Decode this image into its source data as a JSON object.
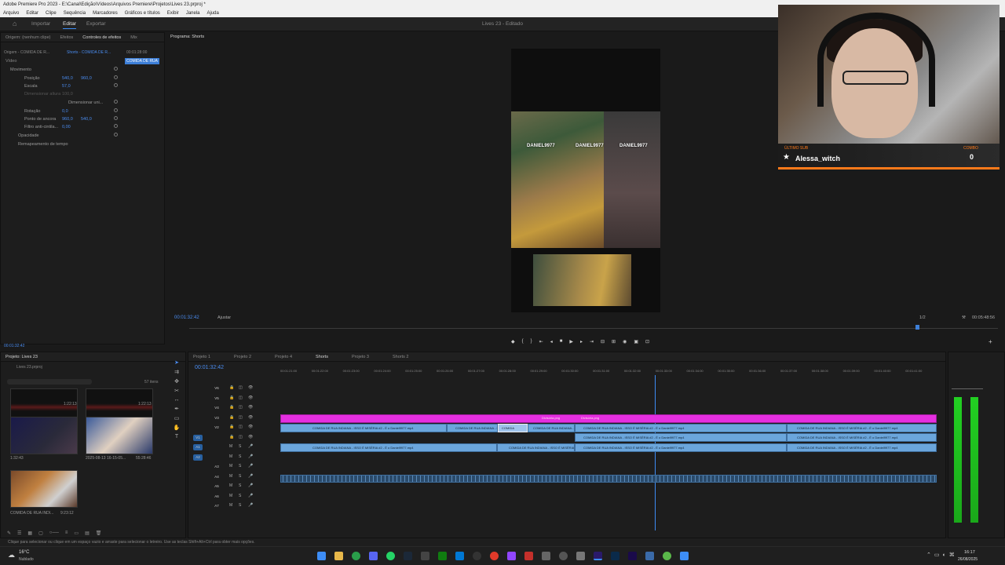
{
  "app": {
    "title": "Adobe Premiere Pro 2023 - E:\\Canal\\Edição\\Vídeos\\Arquivos Premiere\\Projetos\\Lives 23.prproj *",
    "project_status": "Lives 23 - Editado"
  },
  "menu": [
    "Arquivo",
    "Editar",
    "Clipe",
    "Sequência",
    "Marcadores",
    "Gráficos e títulos",
    "Exibir",
    "Janela",
    "Ajuda"
  ],
  "workspaces": {
    "import": "Importar",
    "edit": "Editar",
    "export": "Exportar"
  },
  "effects_panel": {
    "tabs": [
      "Origem: (nenhum clipe)",
      "Efeitos",
      "Controles de efeitos",
      "Mix",
      "Programa: Shorts"
    ],
    "source_label": "Origem - COMIDA DE R...",
    "sequence_label": "Shorts - COMIDA DE R...",
    "timecode": "00:01:28:00",
    "clip_label": "COMIDA DE RUA",
    "section_video": "Vídeo",
    "rows": [
      {
        "label": "Movimento"
      },
      {
        "label": "Posição",
        "v1": "540,0",
        "v2": "960,0"
      },
      {
        "label": "Escala",
        "v1": "57,0"
      },
      {
        "label": "Dimensionar altura",
        "v1": "100,0"
      },
      {
        "label": "Dimensionar uni..."
      },
      {
        "label": "Rotação",
        "v1": "0,0"
      },
      {
        "label": "Ponto de ancora",
        "v1": "960,0",
        "v2": "540,0"
      },
      {
        "label": "Filtro anti-cintila...",
        "v1": "0,00"
      },
      {
        "label": "Opacidade"
      },
      {
        "label": "Remapeamento de tempo"
      }
    ],
    "footer_timecode": "00:01:32:42"
  },
  "program_monitor": {
    "title": "Programa: Shorts",
    "timecode": "00:01:32:42",
    "fit": "Ajustar",
    "scale": "1/2",
    "duration": "00:05:48:56",
    "watermark": "DANIEL9977"
  },
  "stream_alert": {
    "last_sub_label": "ÚLTIMO SUB",
    "last_sub": "Alessa_witch",
    "combo_label": "COMBO",
    "combo": "0",
    "accent": "#ff7a1a"
  },
  "project_panel": {
    "title": "Projeto: Lives 23",
    "file": "Lives 23.prproj",
    "items_count": "57 itens",
    "items": [
      {
        "name": "",
        "dur": "1:22:13"
      },
      {
        "name": "",
        "dur": "1:22:13"
      },
      {
        "name": "",
        "dur": "1:32:43"
      },
      {
        "name": "2025-08-13 16-15-05...",
        "dur": "55:28:46"
      },
      {
        "name": "COMIDA DE RUA INDI...",
        "dur": "9:23:12"
      }
    ]
  },
  "timeline": {
    "tabs": [
      "Projeto 1",
      "Projeto 2",
      "Projeto 4",
      "Shorts",
      "Projeto 3",
      "Shorts 2"
    ],
    "active_tab": "Shorts",
    "timecode": "00:01:32:42",
    "ruler": [
      "00:01:21:00",
      "00:01:22:00",
      "00:01:23:00",
      "00:01:24:00",
      "00:01:25:00",
      "00:01:26:00",
      "00:01:27:00",
      "00:01:28:00",
      "00:01:29:00",
      "00:01:30:00",
      "00:01:31:00",
      "00:01:32:00",
      "00:01:33:00",
      "00:01:34:00",
      "00:01:35:00",
      "00:01:36:00",
      "00:01:37:00",
      "00:01:38:00",
      "00:01:39:00",
      "00:01:40:00",
      "00:01:41:00"
    ],
    "video_tracks": [
      "V6",
      "V5",
      "V4",
      "V3",
      "V2",
      "V1"
    ],
    "audio_tracks": [
      "A1",
      "A2",
      "A3",
      "A4",
      "A5",
      "A6",
      "A7"
    ],
    "clip_text": "COMIDA DE RUA INDIANA - ISSO É MISÉRIA #2 - É o Daniel9977.mp4",
    "overlay_text": "Divisória.png",
    "short_clip": "COMIDA"
  },
  "status": {
    "hint": "Clique para selecionar ou clique em um espaço vazio e arraste para selecionar o letreiro. Use as teclas Shift+Alt+Ctrl para obter mais opções."
  },
  "taskbar": {
    "weather_temp": "16°C",
    "weather": "Nublado",
    "time": "16:17",
    "date": "26/08/2025"
  }
}
